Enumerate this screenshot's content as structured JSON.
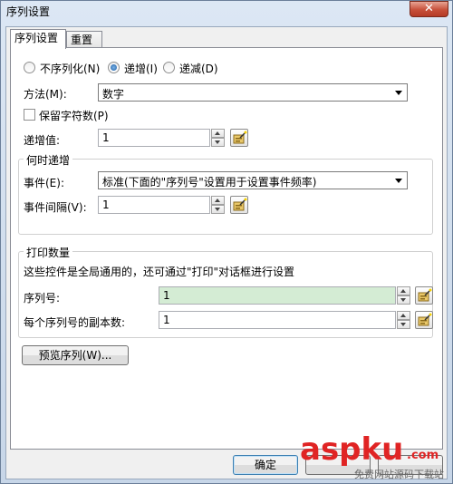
{
  "window": {
    "title": "序列设置",
    "close_glyph": "✕"
  },
  "tabs": [
    {
      "label": "序列设置",
      "active": true
    },
    {
      "label": "重置",
      "active": false
    }
  ],
  "mode": {
    "options": [
      {
        "label": "不序列化(N)",
        "selected": false
      },
      {
        "label": "递增(I)",
        "selected": true
      },
      {
        "label": "递减(D)",
        "selected": false
      }
    ]
  },
  "method": {
    "label": "方法(M):",
    "value": "数字"
  },
  "keep_chars": {
    "label": "保留字符数(P)",
    "checked": false
  },
  "increment": {
    "label": "递增值:",
    "value": "1"
  },
  "when": {
    "title": "何时递增",
    "event_label": "事件(E):",
    "event_value": "标准(下面的\"序列号\"设置用于设置事件频率)",
    "interval_label": "事件间隔(V):",
    "interval_value": "1"
  },
  "print": {
    "title": "打印数量",
    "note": "这些控件是全局通用的，还可通过\"打印\"对话框进行设置",
    "serial_label": "序列号:",
    "serial_value": "1",
    "copies_label": "每个序列号的副本数:",
    "copies_value": "1"
  },
  "preview_button": "预览序列(W)...",
  "footer": {
    "ok": "确定"
  },
  "watermark": {
    "brand": "aspku",
    "tld": ".com",
    "sub": "免费网站源码下载站"
  },
  "icons": {
    "wizard": "wizard-icon"
  }
}
